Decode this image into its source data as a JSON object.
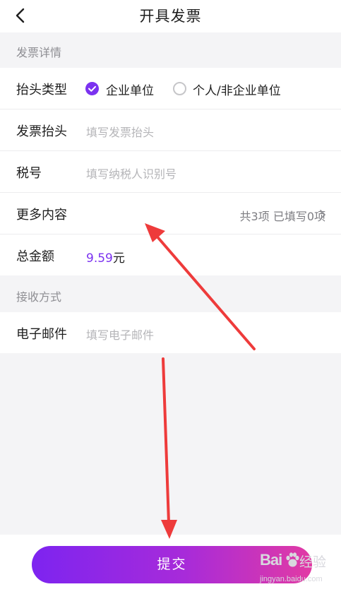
{
  "header": {
    "title": "开具发票",
    "back_icon": "chevron-left-icon"
  },
  "sections": {
    "details_label": "发票详情",
    "receive_label": "接收方式"
  },
  "header_type": {
    "label": "抬头类型",
    "options": [
      {
        "label": "企业单位",
        "selected": true
      },
      {
        "label": "个人/非企业单位",
        "selected": false
      }
    ]
  },
  "invoice_title": {
    "label": "发票抬头",
    "placeholder": "填写发票抬头"
  },
  "tax_id": {
    "label": "税号",
    "placeholder": "填写纳税人识别号"
  },
  "more_content": {
    "label": "更多内容",
    "info": "共3项 已填写0项"
  },
  "total": {
    "label": "总金额",
    "amount": "9.59",
    "unit": "元"
  },
  "email": {
    "label": "电子邮件",
    "placeholder": "填写电子邮件"
  },
  "submit_label": "提交",
  "watermark": {
    "brand": "Bai",
    "cn": "经验",
    "url": "jingyan.baidu.com"
  },
  "colors": {
    "accent": "#7b32f0",
    "arrow": "#ee3b3b",
    "gradient_start": "#7d24f0",
    "gradient_end": "#e23aa4"
  }
}
